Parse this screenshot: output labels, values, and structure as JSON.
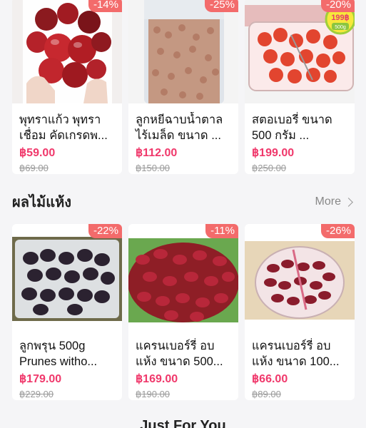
{
  "top_row": [
    {
      "discount": "-14%",
      "name": "พุทราแก้ว พุทราเชื่อม คัดเกรดพ...",
      "price": "฿59.00",
      "old_price": "฿69.00"
    },
    {
      "discount": "-25%",
      "name": "ลูกหยีฉาบน้ำตาล ไร้เมล็ด ขนาด ...",
      "price": "฿112.00",
      "old_price": "฿150.00"
    },
    {
      "discount": "-20%",
      "name": "สตอเบอรี่ ขนาด 500 กรัม ...",
      "price": "฿199.00",
      "old_price": "฿250.00",
      "sticker": "199฿",
      "sticker_sub": "500g"
    }
  ],
  "section": {
    "title": "ผลไม้แห้ง",
    "more_label": "More"
  },
  "dried_fruits": [
    {
      "discount": "-22%",
      "name": "ลูกพรุน 500g Prunes witho...",
      "price": "฿179.00",
      "old_price": "฿229.00"
    },
    {
      "discount": "-11%",
      "name": "แครนเบอร์รี่ อบแห้ง ขนาด 500...",
      "price": "฿169.00",
      "old_price": "฿190.00"
    },
    {
      "discount": "-26%",
      "name": "แครนเบอร์รี่ อบแห้ง ขนาด 100...",
      "price": "฿66.00",
      "old_price": "฿89.00"
    }
  ],
  "next_section_title": "Just For You",
  "colors": {
    "price": "#f0386b",
    "badge": "#f36b6b",
    "background": "#f5f5f7"
  }
}
